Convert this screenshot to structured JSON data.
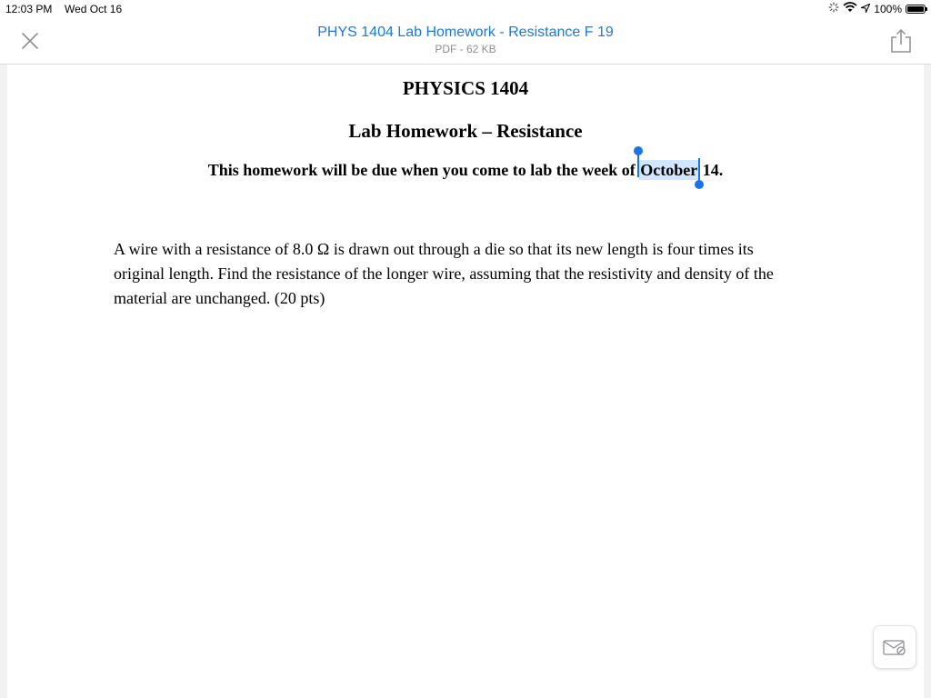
{
  "status_bar": {
    "time": "12:03 PM",
    "date": "Wed Oct 16",
    "battery": "100%"
  },
  "nav": {
    "title": "PHYS 1404 Lab Homework - Resistance F 19",
    "subtitle": "PDF - 62 KB"
  },
  "document": {
    "title": "PHYSICS 1404",
    "subtitle": "Lab Homework – Resistance",
    "due_prefix": "This homework will be due when you come to lab the week of",
    "due_selected": "October",
    "due_suffix": "14.",
    "problem": "A wire with a resistance of 8.0 Ω is drawn out through a die so that its new length is four times its original length.  Find the resistance of the longer wire, assuming that the resistivity and density of the material are unchanged.  (20 pts)"
  },
  "colors": {
    "accent": "#1a7ae0",
    "selection_handle": "#1a73e8",
    "subtitle_gray": "#8e8e93"
  },
  "icons": {
    "close": "close-icon",
    "share": "share-icon",
    "annotate": "markup-icon",
    "wifi": "wifi-icon",
    "location": "location-icon",
    "activity": "activity-spinner-icon",
    "battery": "battery-icon"
  }
}
